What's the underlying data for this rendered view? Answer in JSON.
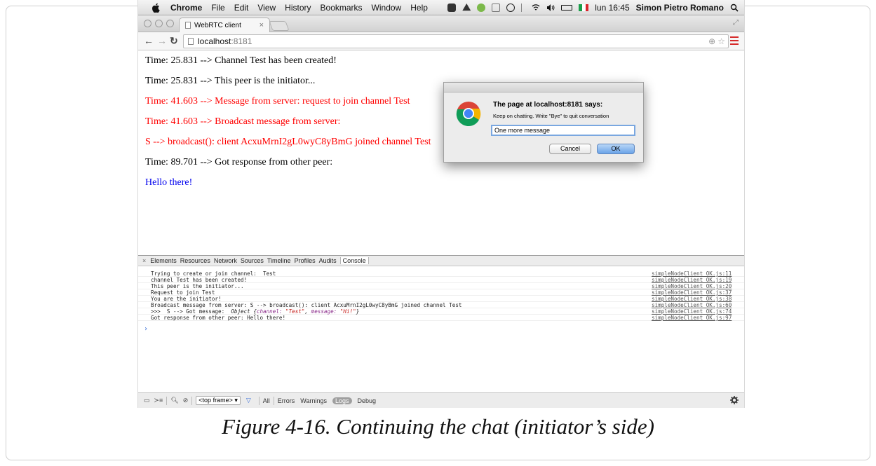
{
  "menubar": {
    "app": "Chrome",
    "items": [
      "File",
      "Edit",
      "View",
      "History",
      "Bookmarks",
      "Window",
      "Help"
    ],
    "clock": "lun 16:45",
    "user": "Simon Pietro Romano"
  },
  "browser": {
    "tab_title": "WebRTC client",
    "url_host": "localhost",
    "url_port": ":8181"
  },
  "page_lines": [
    {
      "text": "Time: 25.831 --> Channel Test has been created!",
      "color": "#000000"
    },
    {
      "text": "Time: 25.831 --> This peer is the initiator...",
      "color": "#000000"
    },
    {
      "text": "Time: 41.603 --> Message from server: request to join channel Test",
      "color": "#ff0000"
    },
    {
      "text": "Time: 41.603 --> Broadcast message from server:",
      "color": "#ff0000"
    },
    {
      "text": "S --> broadcast(): client AcxuMrnI2gL0wyC8yBmG joined channel Test",
      "color": "#ff0000"
    },
    {
      "text": "Time: 89.701 --> Got response from other peer:",
      "color": "#000000"
    },
    {
      "text": "Hello there!",
      "color": "#0000ee"
    }
  ],
  "dialog": {
    "title": "The page at localhost:8181 says:",
    "message": "Keep on chatting. Write \"Bye\" to quit conversation",
    "input_value": "One more message",
    "cancel_label": "Cancel",
    "ok_label": "OK"
  },
  "devtools": {
    "tabs": [
      "Elements",
      "Resources",
      "Network",
      "Sources",
      "Timeline",
      "Profiles",
      "Audits",
      "Console"
    ],
    "active_tab": "Console",
    "console_rows": [
      {
        "text": "Trying to create or join channel:  Test",
        "source": "simpleNodeClient_OK.js:11"
      },
      {
        "text": "channel Test has been created!",
        "source": "simpleNodeClient_OK.js:19"
      },
      {
        "text": "This peer is the initiator...",
        "source": "simpleNodeClient_OK.js:20"
      },
      {
        "text": "Request to join Test",
        "source": "simpleNodeClient_OK.js:37"
      },
      {
        "text": "You are the initiator!",
        "source": "simpleNodeClient_OK.js:38"
      },
      {
        "text": "Broadcast message from server: S --> broadcast(): client AcxuMrnI2gL0wyC8yBmG joined channel Test",
        "source": "simpleNodeClient_OK.js:60"
      },
      {
        "text": ">>>  S --> Got message:",
        "source": "simpleNodeClient_OK.js:74"
      },
      {
        "text": "Got response from other peer: Hello there!",
        "source": "simpleNodeClient_OK.js:97"
      }
    ],
    "object_row": {
      "prefix": "Object {",
      "key1": "channel:",
      "val1": "\"Test\"",
      "sep": ", ",
      "key2": "message:",
      "val2": "\"Hi!\"",
      "suffix": "}"
    },
    "prompt": "›",
    "frame_select": "<top frame> ▾",
    "filters": [
      "All",
      "Errors",
      "Warnings",
      "Logs",
      "Debug"
    ]
  },
  "caption": "Figure 4-16. Continuing the chat (initiator’s side)"
}
